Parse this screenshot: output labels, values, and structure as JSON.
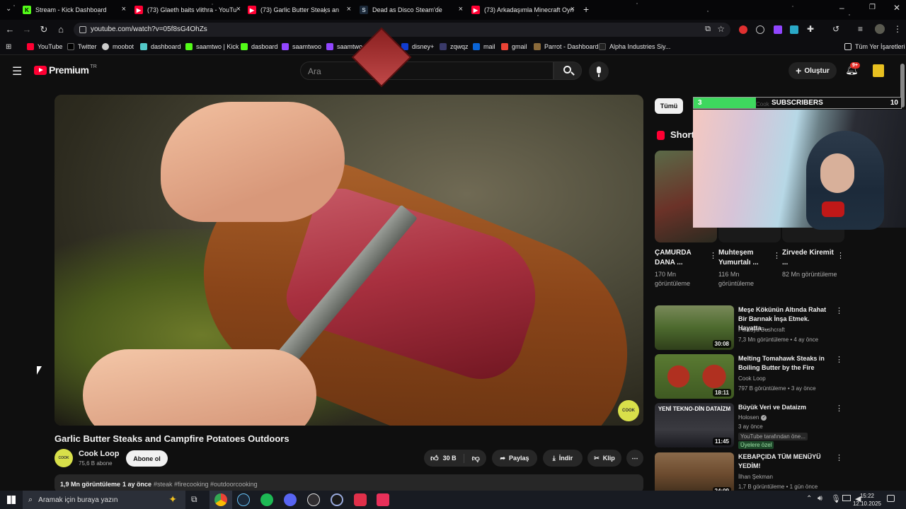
{
  "browser": {
    "tabs": [
      {
        "label": "Stream - Kick Dashboard",
        "icon": "kick-icon",
        "color": "#53fc18"
      },
      {
        "label": "(73) Glaeth baits vlithra - YouTu",
        "icon": "youtube-icon",
        "color": "#ff0033"
      },
      {
        "label": "(73) Garlic Butter Steaks an",
        "icon": "youtube-icon",
        "color": "#ff0033"
      },
      {
        "label": "Dead as Disco Steam'de",
        "icon": "steam-icon",
        "color": "#c7d5e0"
      },
      {
        "label": "(73) Arkadaşımla Minecraft Oyn",
        "icon": "youtube-icon",
        "color": "#ff0033"
      }
    ],
    "url": "youtube.com/watch?v=05f8sG4OhZs",
    "bookmarks": [
      {
        "label": "YouTube"
      },
      {
        "label": "Twitter"
      },
      {
        "label": "moobot"
      },
      {
        "label": "dashboard"
      },
      {
        "label": "saamtwo | Kick"
      },
      {
        "label": "dasboard"
      },
      {
        "label": "saamtwoo"
      },
      {
        "label": "saamtwo"
      },
      {
        "label": "disney+"
      },
      {
        "label": "zqwqz"
      },
      {
        "label": "mail"
      },
      {
        "label": "gmail"
      },
      {
        "label": "Parrot - Dashboard"
      },
      {
        "label": "Alpha Industries Siy..."
      }
    ],
    "all_bookmarks": "Tüm Yer İşaretleri"
  },
  "yt": {
    "logo": "Premium",
    "logo_sup": "TR",
    "search_placeholder": "Ara",
    "create_label": "Oluştur",
    "notif_badge": "9+"
  },
  "video": {
    "title": "Garlic Butter Steaks and Campfire Potatoes Outdoors",
    "channel": "Cook Loop",
    "subs": "75,6 B abone",
    "subscribe": "Abone ol",
    "likes": "30 B",
    "share": "Paylaş",
    "download": "İndir",
    "clip": "Klip",
    "views": "1,9 Mn görüntüleme",
    "age": "1 ay önce",
    "tags": "#steak #firecooking #outdoorcooking"
  },
  "sidebar": {
    "chip_all": "Tümü",
    "shorts_heading": "Short",
    "shorts": [
      {
        "title": "ÇAMURDA DANA ...",
        "views": "170 Mn görüntüleme"
      },
      {
        "title": "Muhteşem Yumurtalı ...",
        "views": "116 Mn görüntüleme"
      },
      {
        "title": "Zirvede Kiremit ...",
        "views": "82 Mn görüntüleme"
      }
    ],
    "recs": [
      {
        "title": "Meşe Kökünün Altında Rahat Bir Barınak İnşa Etmek. Hayatta ...",
        "channel": "Polissya Bushcraft",
        "meta": "7,3 Mn görüntüleme • 4 ay önce",
        "duration": "30:08",
        "thumb_color": "#4d6a2e"
      },
      {
        "title": "Melting Tomahawk Steaks in Boiling Butter by the Fire",
        "channel": "Cook Loop",
        "meta": "797 B görüntüleme • 3 ay önce",
        "duration": "18:11",
        "thumb_color": "#3f5a22"
      },
      {
        "title": "Büyük Veri ve Dataizm",
        "channel": "Holosen",
        "meta": "3 ay önce",
        "badge1": "YouTube tarafından öne...",
        "badge2": "Üyelere özel",
        "duration": "11:45",
        "thumb_text": "YENİ TEKNO-DİN DATAİZM",
        "thumb_color": "#2a2a30"
      },
      {
        "title": "KEBAPÇIDA TÜM MENÜYÜ YEDİM!",
        "channel": "İlhan Şekman",
        "meta": "1,7 B görüntüleme • 1 gün önce",
        "duration": "24:09",
        "thumb_color": "#6b4a2e"
      }
    ]
  },
  "overlay": {
    "sub_current": "3",
    "sub_label": "SUBSCRIBERS",
    "sub_goal": "10",
    "progress_fraction": 0.3,
    "hidden_text": "Cook"
  },
  "taskbar": {
    "search_placeholder": "Aramak için buraya yazın",
    "time": "15:22",
    "date": "12.10.2025"
  }
}
